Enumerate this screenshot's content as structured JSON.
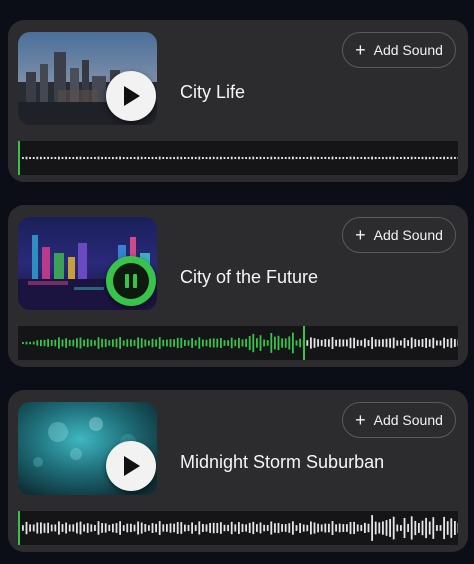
{
  "cards": [
    {
      "title": "City Life",
      "add_label": "Add Sound",
      "state": "paused",
      "progress": 0.0,
      "wave_profile": "flat"
    },
    {
      "title": "City of the Future",
      "add_label": "Add Sound",
      "state": "playing",
      "progress": 0.65,
      "wave_profile": "mid"
    },
    {
      "title": "Midnight Storm Suburban",
      "add_label": "Add Sound",
      "state": "paused",
      "progress": 0.0,
      "wave_profile": "storm"
    }
  ],
  "colors": {
    "background": "#0b0d17",
    "card": "#2c2c2f",
    "accent_green": "#38c44a",
    "wave_unplayed": "#e6e6ea",
    "text": "#f5f5f5"
  },
  "icons": {
    "play": "play-icon",
    "pause": "pause-icon",
    "plus": "plus-icon"
  }
}
